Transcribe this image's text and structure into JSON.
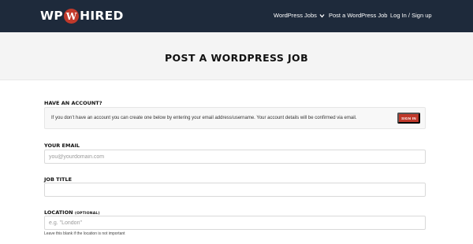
{
  "logo": {
    "left_text": "WP",
    "badge_letter": "W",
    "right_text": "HIRED"
  },
  "nav": {
    "items": [
      {
        "label": "WordPress Jobs",
        "has_dropdown": true,
        "icon": "chevron-down-icon"
      },
      {
        "label": "Post a WordPress Job"
      },
      {
        "label": "Log In / Sign up"
      }
    ]
  },
  "page": {
    "title": "POST A WORDPRESS JOB"
  },
  "account": {
    "label": "HAVE AN ACCOUNT?",
    "notice": "If you don’t have an account you can create one below by entering your email address/username. Your account details will be confirmed via email.",
    "signin_label": "SIGN IN"
  },
  "form": {
    "email": {
      "label": "YOUR EMAIL",
      "placeholder": "you@yourdomain.com",
      "value": ""
    },
    "job_title": {
      "label": "JOB TITLE",
      "placeholder": "",
      "value": ""
    },
    "location": {
      "label": "LOCATION",
      "optional": "(OPTIONAL)",
      "placeholder": "e.g. \"London\"",
      "value": "",
      "help": "Leave this blank if the location is not important"
    }
  },
  "colors": {
    "nav_bg": "#1e2a3b",
    "accent": "#c0392b",
    "hero_bg": "#f4f4f4"
  }
}
